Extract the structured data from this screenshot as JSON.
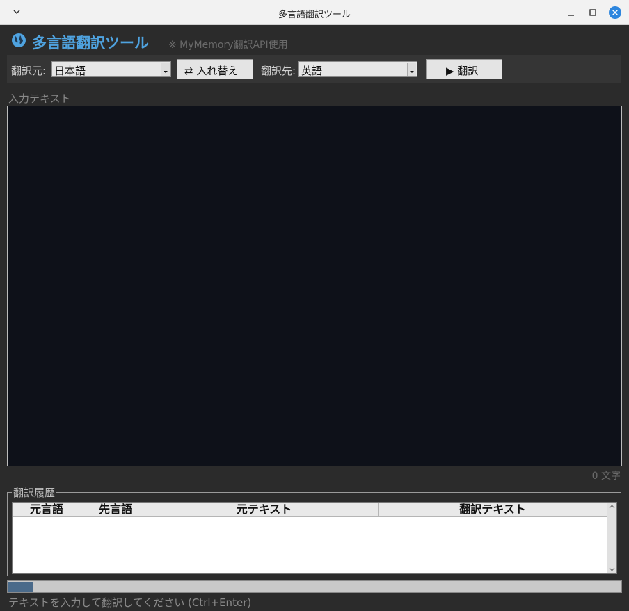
{
  "window": {
    "title": "多言語翻訳ツール"
  },
  "header": {
    "title": "多言語翻訳ツール",
    "api_note": "※ MyMemory翻訳API使用"
  },
  "lang_bar": {
    "source_label": "翻訳元:",
    "source_value": "日本語",
    "swap_label": "⇄ 入れ替え",
    "target_label": "翻訳先:",
    "target_value": "英語",
    "translate_label": "▶ 翻訳"
  },
  "input": {
    "label": "入力テキスト",
    "value": "",
    "char_count": "0 文字"
  },
  "history": {
    "legend": "翻訳履歴",
    "columns": [
      "元言語",
      "先言語",
      "元テキスト",
      "翻訳テキスト"
    ]
  },
  "progress": {
    "fraction": 0.04
  },
  "status": {
    "text": "テキストを入力して翻訳してください (Ctrl+Enter)"
  },
  "colors": {
    "accent": "#4fa3e0",
    "background": "#2b2b2b",
    "input_bg": "#0e1119",
    "close_button": "#2e86de"
  }
}
